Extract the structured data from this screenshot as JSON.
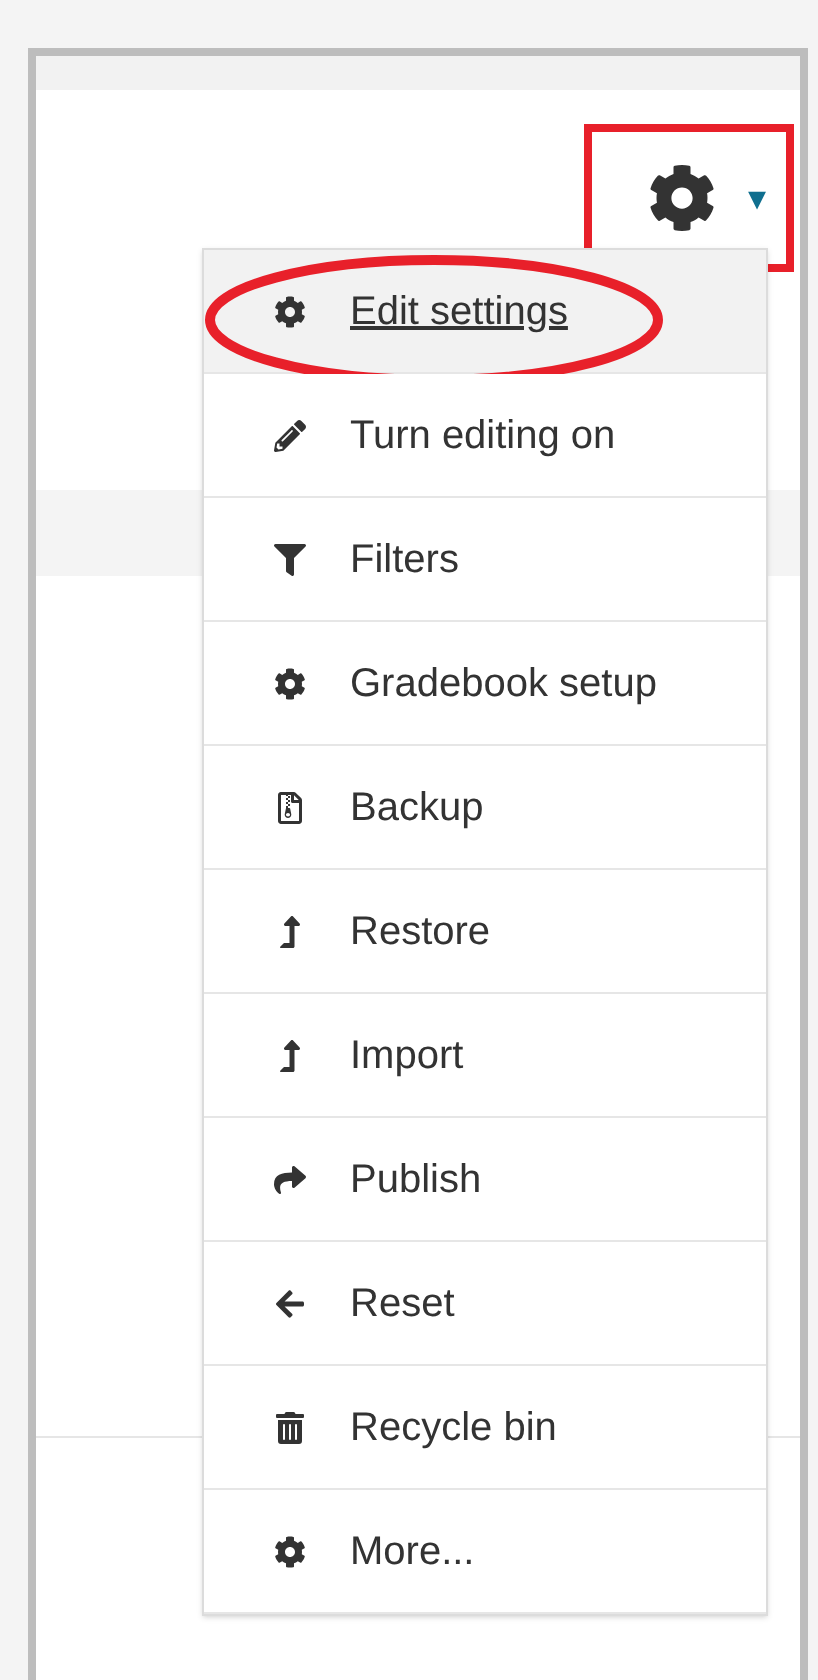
{
  "settings_button": {
    "boxed": true,
    "caret": "▾"
  },
  "menu": {
    "items": [
      {
        "kind": "gear",
        "label": "Edit settings",
        "selected": true,
        "circled": true
      },
      {
        "kind": "pencil",
        "label": "Turn editing on",
        "selected": false,
        "circled": false
      },
      {
        "kind": "filter",
        "label": "Filters",
        "selected": false,
        "circled": false
      },
      {
        "kind": "gear",
        "label": "Gradebook setup",
        "selected": false,
        "circled": false
      },
      {
        "kind": "archive",
        "label": "Backup",
        "selected": false,
        "circled": false
      },
      {
        "kind": "levelup",
        "label": "Restore",
        "selected": false,
        "circled": false
      },
      {
        "kind": "levelup",
        "label": "Import",
        "selected": false,
        "circled": false
      },
      {
        "kind": "share",
        "label": "Publish",
        "selected": false,
        "circled": false
      },
      {
        "kind": "back",
        "label": "Reset",
        "selected": false,
        "circled": false
      },
      {
        "kind": "trash",
        "label": "Recycle bin",
        "selected": false,
        "circled": false
      },
      {
        "kind": "gear",
        "label": "More...",
        "selected": false,
        "circled": false
      }
    ]
  }
}
